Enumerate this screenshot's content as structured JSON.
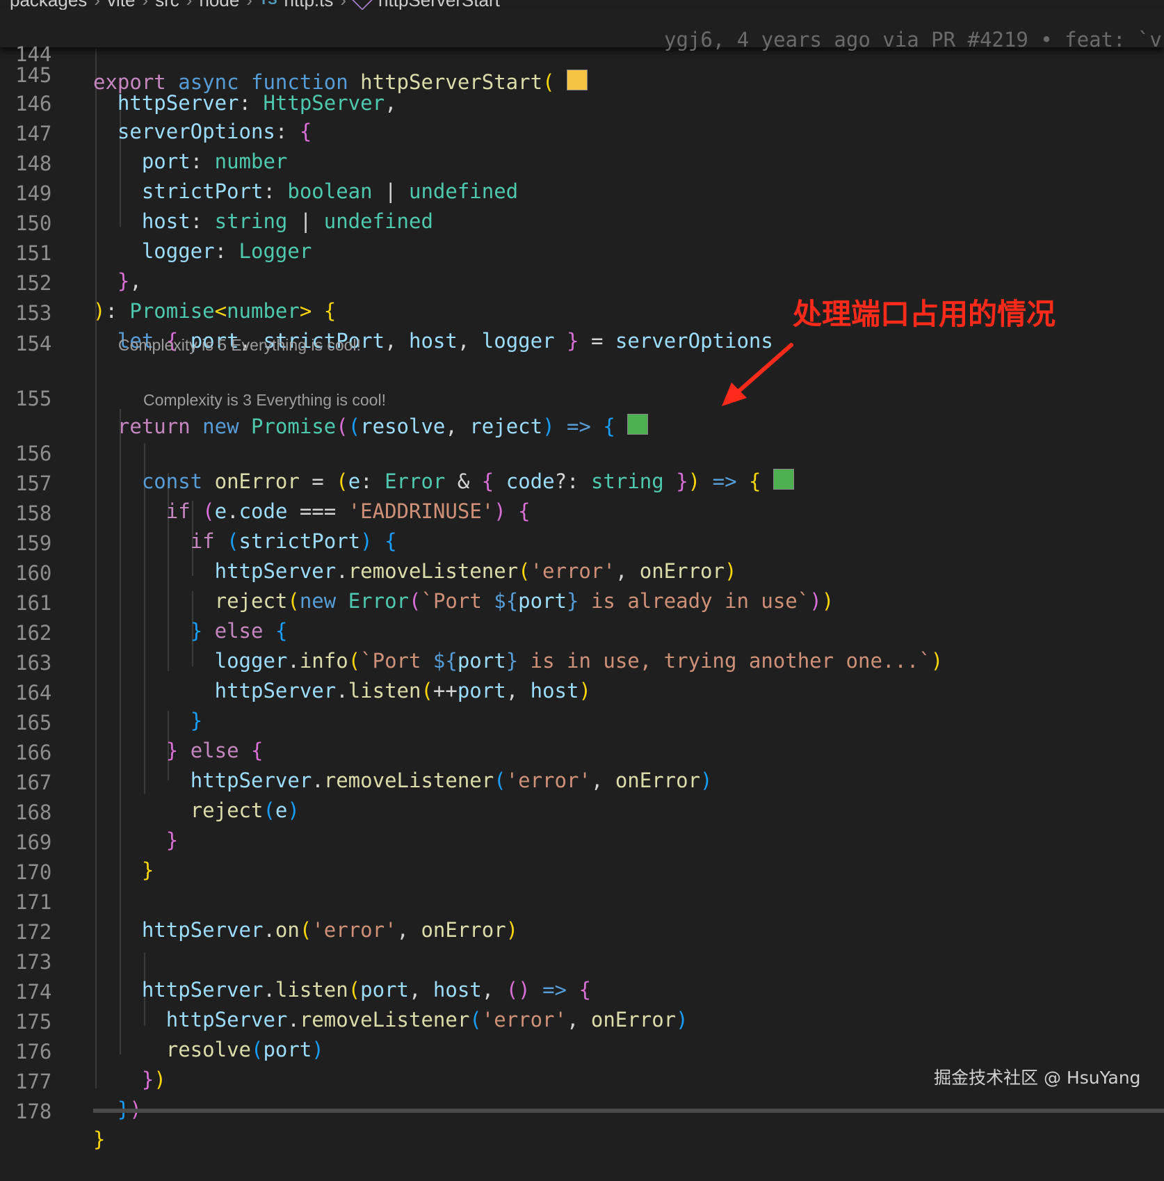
{
  "breadcrumb": {
    "items": [
      "packages",
      "vite",
      "src",
      "node",
      "http.ts",
      "httpServerStart"
    ],
    "file_icon": "ts-file-icon",
    "symbol_icon": "method-cube-icon"
  },
  "sticky_line": {
    "number": "144",
    "text": "export async function httpServerStart("
  },
  "blame": "ygj6, 4 years ago via  PR #4219 • feat: `v",
  "code_lens": {
    "line_155": "Complexity is 5 Everything is cool!",
    "line_156": "Complexity is 3 Everything is cool!"
  },
  "line_numbers": [
    "145",
    "146",
    "147",
    "148",
    "149",
    "150",
    "151",
    "152",
    "153",
    "154",
    "155",
    "156",
    "157",
    "158",
    "159",
    "160",
    "161",
    "162",
    "163",
    "164",
    "165",
    "166",
    "167",
    "168",
    "169",
    "170",
    "171",
    "172",
    "173",
    "174",
    "175",
    "176",
    "177",
    "178"
  ],
  "annotation": "处理端口占用的情况",
  "watermark": "掘金技术社区 @ HsuYang",
  "colors": {
    "background": "#1f1f1f",
    "keyword": "#c586c0",
    "storage": "#569cd6",
    "function": "#dcdcaa",
    "variable": "#9cdcfe",
    "type": "#4ec9b0",
    "string": "#ce9178",
    "annotation": "#ff2a1a",
    "status_square_yellow": "#f5c542",
    "status_square_green": "#4caf50"
  }
}
